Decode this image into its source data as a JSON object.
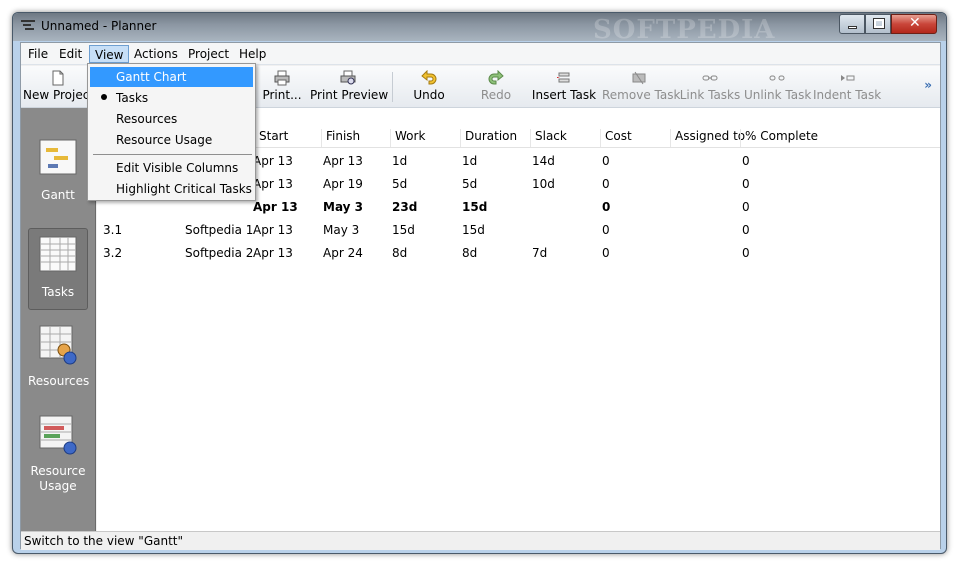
{
  "window": {
    "title": "Unnamed - Planner",
    "watermark": "SOFTPEDIA"
  },
  "menubar": {
    "items": [
      {
        "label": "File"
      },
      {
        "label": "Edit"
      },
      {
        "label": "View"
      },
      {
        "label": "Actions"
      },
      {
        "label": "Project"
      },
      {
        "label": "Help"
      }
    ]
  },
  "toolbar": {
    "new_project": "New Project",
    "print": "Print...",
    "print_preview": "Print Preview",
    "undo": "Undo",
    "redo": "Redo",
    "insert_task": "Insert Task",
    "remove_task": "Remove Task",
    "link_tasks": "Link Tasks",
    "unlink_task": "Unlink Task",
    "indent_task": "Indent Task",
    "overflow": "»"
  },
  "sidebar": {
    "items": [
      {
        "label": "Gantt",
        "icon": "gantt-icon"
      },
      {
        "label": "Tasks",
        "icon": "tasks-icon",
        "selected": true
      },
      {
        "label": "Resources",
        "icon": "resources-icon"
      },
      {
        "label": "Resource\nUsage",
        "icon": "resource-usage-icon"
      }
    ]
  },
  "table": {
    "headers": [
      "Start",
      "Finish",
      "Work",
      "Duration",
      "Slack",
      "Cost",
      "Assigned to",
      "% Complete"
    ],
    "rows": [
      {
        "wbs": "",
        "name": "",
        "start": "Apr 13",
        "finish": "Apr 13",
        "work": "1d",
        "duration": "1d",
        "slack": "14d",
        "cost": "0",
        "assigned": "",
        "complete": "0",
        "bold": false
      },
      {
        "wbs": "",
        "name": "",
        "start": "Apr 13",
        "finish": "Apr 19",
        "work": "5d",
        "duration": "5d",
        "slack": "10d",
        "cost": "0",
        "assigned": "",
        "complete": "0",
        "bold": false
      },
      {
        "wbs": "",
        "name": "",
        "start": "Apr 13",
        "finish": "May 3",
        "work": "23d",
        "duration": "15d",
        "slack": "",
        "cost": "0",
        "assigned": "",
        "complete": "0",
        "bold": true
      },
      {
        "wbs": "3.1",
        "name": "Softpedia 1",
        "start": "Apr 13",
        "finish": "May 3",
        "work": "15d",
        "duration": "15d",
        "slack": "",
        "cost": "0",
        "assigned": "",
        "complete": "0",
        "bold": false
      },
      {
        "wbs": "3.2",
        "name": "Softpedia 2",
        "start": "Apr 13",
        "finish": "Apr 24",
        "work": "8d",
        "duration": "8d",
        "slack": "7d",
        "cost": "0",
        "assigned": "",
        "complete": "0",
        "bold": false
      }
    ]
  },
  "view_menu": {
    "items": [
      {
        "label": "Gantt Chart",
        "hover": true
      },
      {
        "label": "Tasks",
        "checked": true
      },
      {
        "label": "Resources"
      },
      {
        "label": "Resource Usage"
      },
      {
        "label": "Edit Visible Columns"
      },
      {
        "label": "Highlight Critical Tasks"
      }
    ]
  },
  "status": {
    "text": "Switch to the view \"Gantt\""
  },
  "colors": {
    "sidebar_bg": "#8a8a8a",
    "menu_highlight": "#3399ff",
    "close_button": "#c9463a"
  }
}
